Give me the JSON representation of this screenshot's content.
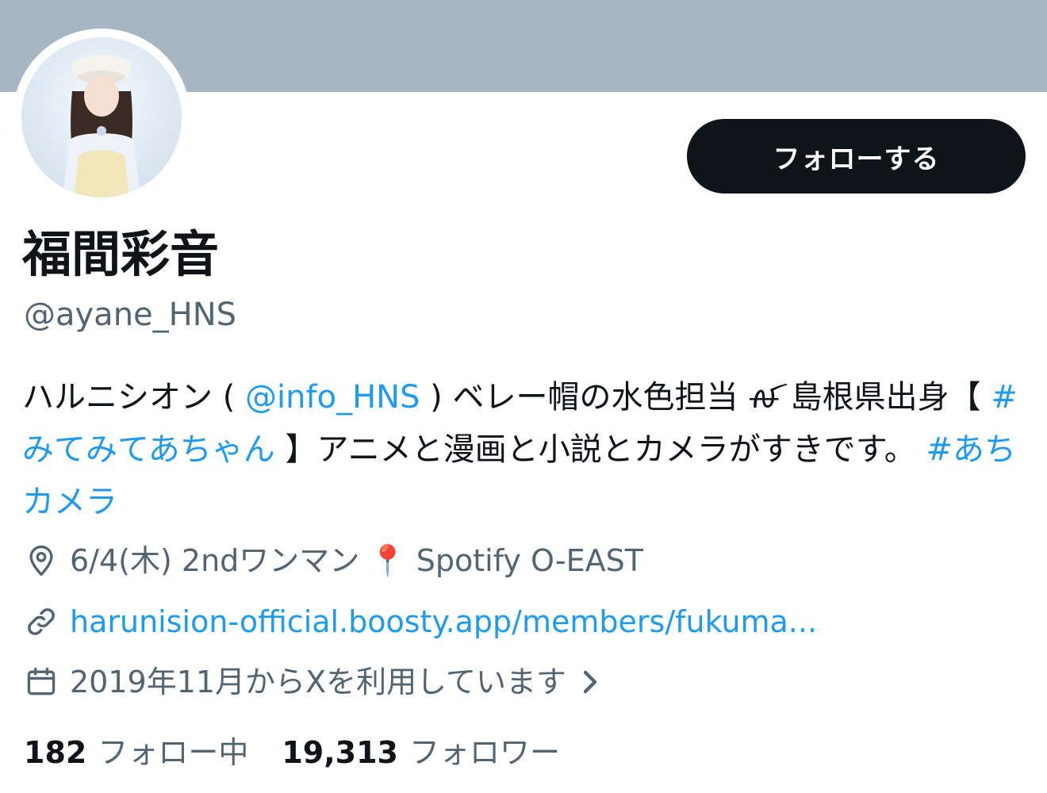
{
  "profile": {
    "display_name": "福間彩音",
    "handle": "@ayane_HNS",
    "follow_button_label": "フォローする",
    "bio": {
      "part1": "ハルニシオン ( ",
      "mention": "@info_HNS",
      "part2": " ) ベレー帽の水色担当 ꫛ 島根県出身【 ",
      "hashtag1": "#みてみてあちゃん",
      "part3": " 】アニメと漫画と小説とカメラがすきです。 ",
      "hashtag2": "#あちカメラ"
    },
    "location": "6/4(木) 2ndワンマン 📍 Spotify O-EAST",
    "website": "harunision-official.boosty.app/members/fukuma...",
    "joined": "2019年11月からXを利用しています",
    "following_count": "182",
    "following_label": "フォロー中",
    "followers_count": "19,313",
    "followers_label": "フォロワー"
  },
  "icons": {
    "location": "location-pin-icon",
    "website": "link-icon",
    "joined": "calendar-icon",
    "chevron": "chevron-right-icon"
  },
  "colors": {
    "banner": "#a8b6c1",
    "link": "#1d9bf0",
    "secondary_text": "#536471",
    "primary_text": "#0f1419",
    "button_bg": "#0f1419"
  }
}
